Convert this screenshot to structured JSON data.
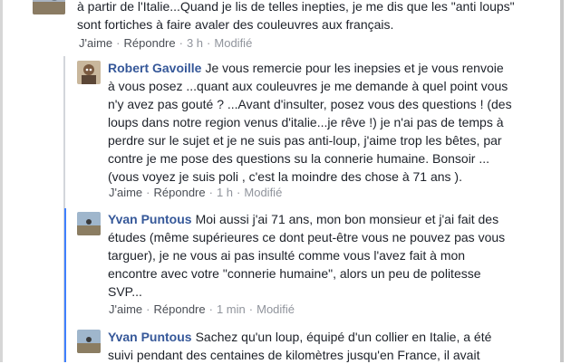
{
  "comments": [
    {
      "author": "",
      "lines": [
        "à partir de l'Italie...Quand je lis de telles inepties, je me dis que les \"anti loups\"",
        "sont fortiches à faire avaler des couleuvres aux français."
      ],
      "like_label": "J'aime",
      "reply_label": "Répondre",
      "time": "3 h",
      "edited": "Modifié"
    },
    {
      "author": "Robert Gavoille",
      "lines": [
        "Je vous remercie pour les inepsies et je vous renvoie",
        "à vous posez ...quant aux couleuvres je me demande à quel point vous",
        "n'y avez pas gouté ? ...Avant d'insulter, posez vous des questions ! (des",
        "loups dans notre region venus d'italie...je rêve !) je n'ai pas de temps à",
        "perdre sur le sujet et je ne suis pas anti-loup, j'aime trop les bêtes, par",
        "contre je me pose des questions su la connerie humaine. Bonsoir ...",
        "(vous voyez je suis poli , c'est la moindre des chose à 71 ans )."
      ],
      "like_label": "J'aime",
      "reply_label": "Répondre",
      "time": "1 h",
      "edited": "Modifié"
    },
    {
      "author": "Yvan Puntous",
      "lines": [
        "Moi aussi j'ai 71 ans, mon bon monsieur et j'ai fait des",
        "études (même supérieures ce dont peut-être vous ne pouvez pas vous",
        "targuer), je ne vous ai pas insulté comme vous l'avez fait à mon",
        "encontre avec votre \"connerie humaine\", alors un peu de politesse",
        "SVP..."
      ],
      "like_label": "J'aime",
      "reply_label": "Répondre",
      "time": "1 min",
      "edited": "Modifié"
    },
    {
      "author": "Yvan Puntous",
      "lines": [
        "Sachez qu'un loup, équipé d'un collier en Italie, a été",
        "suivi pendant des centaines de kilomètres jusqu'en France, il avait"
      ]
    }
  ]
}
